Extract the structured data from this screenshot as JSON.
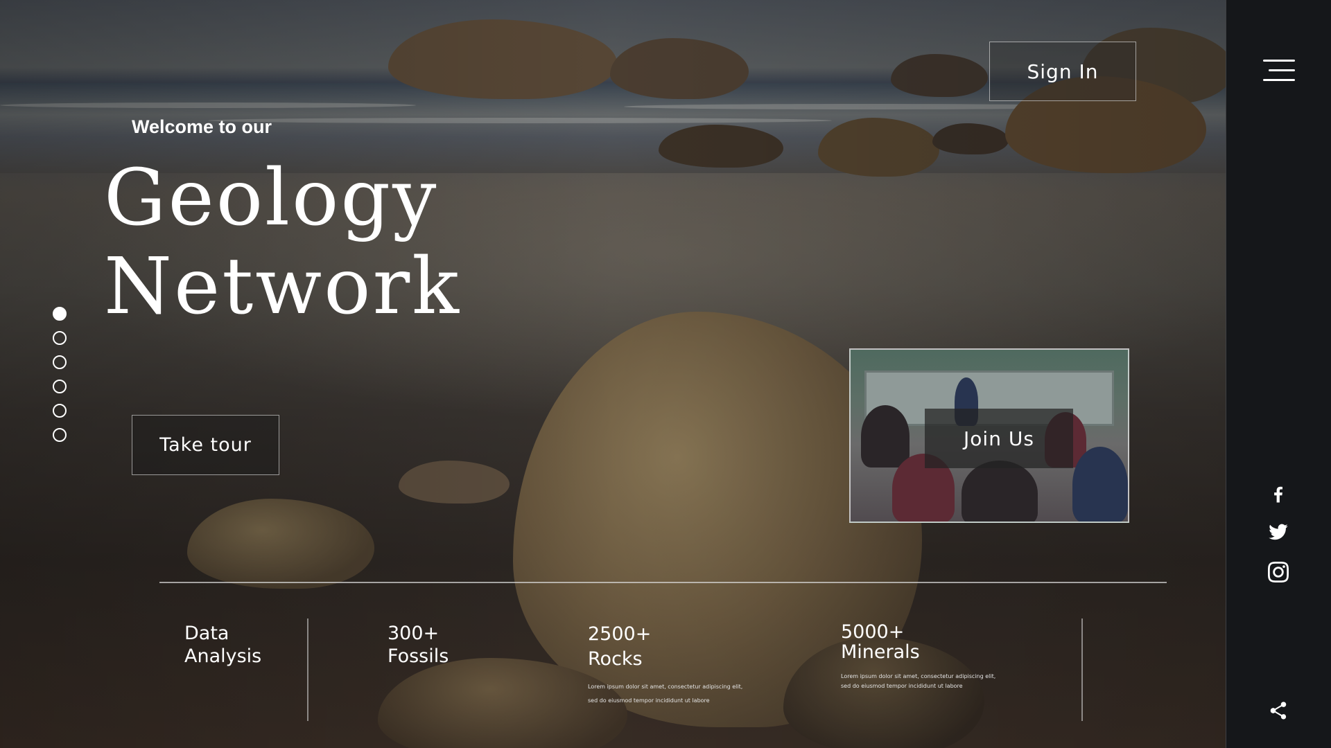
{
  "header": {
    "signin_label": "Sign In"
  },
  "hero": {
    "welcome": "Welcome to our",
    "title_line1": "Geology",
    "title_line2": "Network",
    "tour_label": "Take tour"
  },
  "slider": {
    "count": 6,
    "active_index": 0
  },
  "join": {
    "label": "Join Us"
  },
  "stats": [
    {
      "number": "",
      "label_line1": "Data",
      "label_line2": "Analysis",
      "description": ""
    },
    {
      "number": "300+",
      "label_line1": "Fossils",
      "label_line2": "",
      "description": ""
    },
    {
      "number": "2500+",
      "label_line1": "Rocks",
      "label_line2": "",
      "description_line1": "Lorem ipsum dolor sit amet, consectetur adipiscing elit,",
      "description_line2": "sed do eiusmod tempor incididunt ut labore"
    },
    {
      "number": "5000+",
      "label_line1": "Minerals",
      "label_line2": "",
      "description_line1": "Lorem ipsum dolor sit amet, consectetur adipiscing elit,",
      "description_line2": "sed do eiusmod tempor incididunt ut labore"
    }
  ],
  "sidebar": {
    "icons": [
      "menu-icon",
      "facebook-icon",
      "twitter-icon",
      "instagram-icon",
      "share-icon"
    ]
  },
  "colors": {
    "text": "#ffffff",
    "panel": "#121418"
  }
}
